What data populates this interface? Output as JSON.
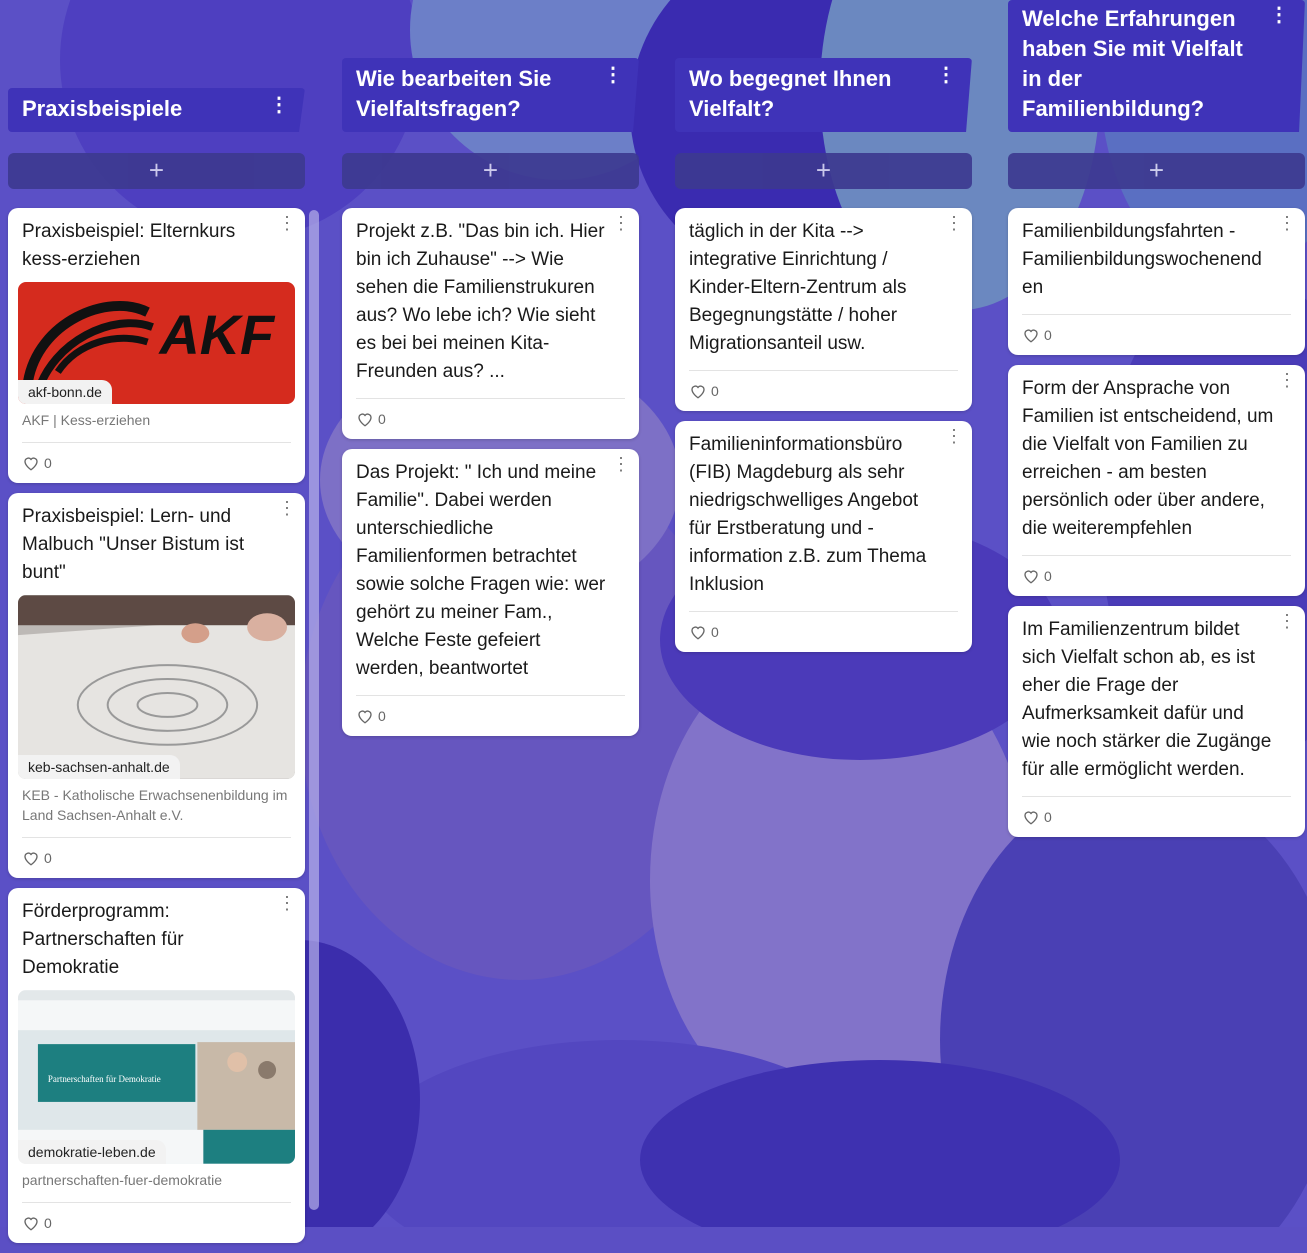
{
  "columns": [
    {
      "title": "Praxisbeispiele",
      "add_label": "+",
      "cards": [
        {
          "text": "Praxisbeispiel: Elternkurs kess-erziehen",
          "link_domain": "akf-bonn.de",
          "link_desc": "AKF | Kess-erziehen",
          "image_text": "AKF",
          "likes": "0"
        },
        {
          "text": "Praxisbeispiel: Lern- und Malbuch \"Unser Bistum ist bunt\"",
          "link_domain": "keb-sachsen-anhalt.de",
          "link_desc": "KEB - Katholische Erwachsenenbildung im Land Sachsen-Anhalt e.V.",
          "likes": "0"
        },
        {
          "text": "Förderprogramm: Partnerschaften für Demokratie",
          "link_domain": "demokratie-leben.de",
          "link_desc": "partnerschaften-fuer-demokratie",
          "image_text": "Partnerschaften für Demokratie",
          "likes": "0"
        }
      ]
    },
    {
      "title": "Wie bearbeiten Sie Vielfaltsfragen?",
      "add_label": "+",
      "cards": [
        {
          "text": "Projekt z.B. \"Das bin ich. Hier bin ich Zuhause\" --> Wie sehen die Familienstrukuren aus? Wo lebe ich? Wie sieht es bei bei meinen Kita-Freunden aus? ...",
          "likes": "0"
        },
        {
          "text": "Das Projekt: \" Ich und meine Familie\". Dabei werden unterschiedliche Familienformen betrachtet sowie solche Fragen wie: wer gehört zu meiner Fam., Welche Feste gefeiert werden, beantwortet",
          "likes": "0"
        }
      ]
    },
    {
      "title": "Wo begegnet Ihnen Vielfalt?",
      "add_label": "+",
      "cards": [
        {
          "text": "täglich in der Kita --> integrative Einrichtung / Kinder-Eltern-Zentrum als Begegnungstätte / hoher Migrationsanteil usw.",
          "likes": "0"
        },
        {
          "text": "Familieninformationsbüro (FIB) Magdeburg als sehr niedrigschwelliges Angebot für Erstberatung und -information z.B. zum Thema Inklusion",
          "likes": "0"
        }
      ]
    },
    {
      "title": "Welche Erfahrungen haben Sie mit Vielfalt in der Familienbildung?",
      "add_label": "+",
      "cards": [
        {
          "text": "Familienbildungsfahrten - Familienbildungswochenend en",
          "likes": "0"
        },
        {
          "text": "Form der Ansprache von Familien ist entscheidend, um die Vielfalt von Familien zu erreichen - am besten persönlich oder über andere, die weiterempfehlen",
          "likes": "0"
        },
        {
          "text": "Im Familienzentrum bildet sich Vielfalt schon ab, es ist eher die Frage der Aufmerksamkeit dafür und wie noch stärker die Zugänge für alle ermöglicht werden.",
          "likes": "0"
        }
      ]
    }
  ],
  "colors": {
    "background": "#5b4fc4",
    "header": "#3f33b8",
    "akf_red": "#d52b1e"
  }
}
